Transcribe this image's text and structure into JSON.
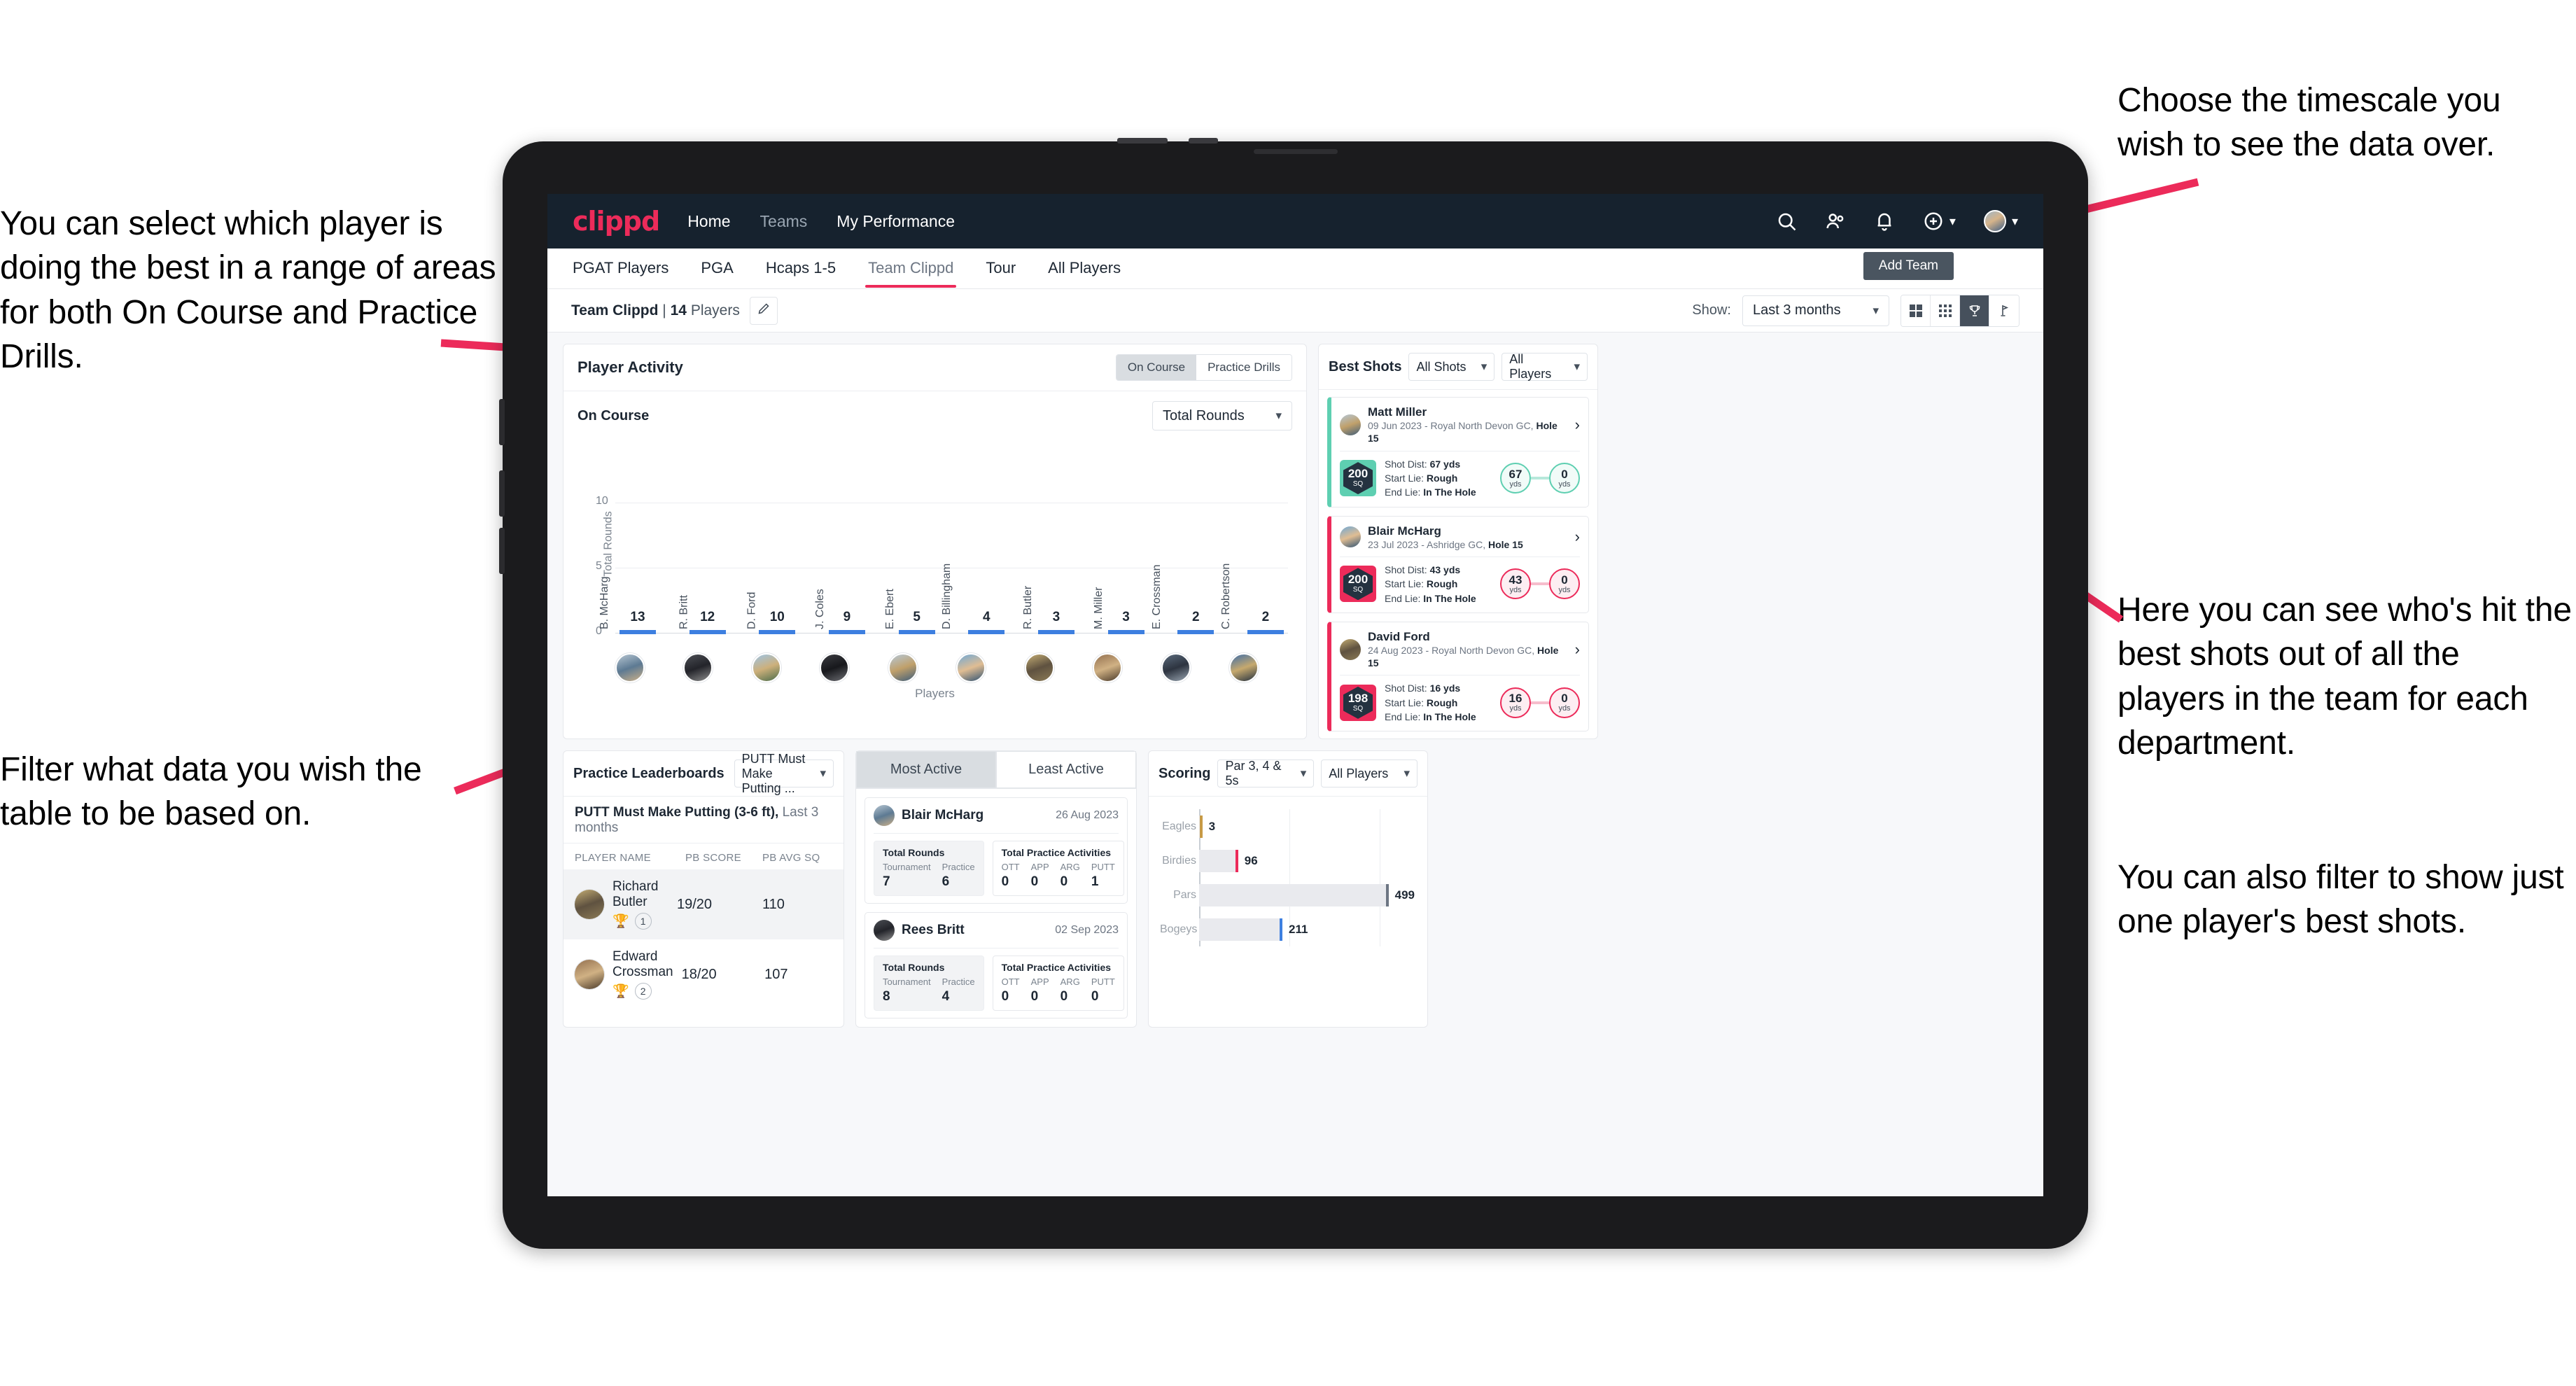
{
  "annotations": {
    "top_right": "Choose the timescale you wish to see the data over.",
    "left_top": "You can select which player is doing the best in a range of areas for both On Course and Practice Drills.",
    "left_bottom": "Filter what data you wish the table to be based on.",
    "right_mid": "Here you can see who's hit the best shots out of all the players in the team for each department.",
    "right_bottom": "You can also filter to show just one player's best shots."
  },
  "topnav": {
    "logo": "clippd",
    "links": [
      {
        "label": "Home",
        "active": true
      },
      {
        "label": "Teams",
        "active": false
      },
      {
        "label": "My Performance",
        "active": true
      }
    ],
    "icons": [
      "search-icon",
      "people-icon",
      "bell-icon",
      "plus-circle-icon",
      "avatar"
    ]
  },
  "tabs": [
    {
      "label": "PGAT Players",
      "active": false
    },
    {
      "label": "PGA",
      "active": false
    },
    {
      "label": "Hcaps 1-5",
      "active": false
    },
    {
      "label": "Team Clippd",
      "active": true
    },
    {
      "label": "Tour",
      "active": false
    },
    {
      "label": "All Players",
      "active": false
    }
  ],
  "add_team_button": "Add Team",
  "toolbar": {
    "team_name": "Team Clippd",
    "separator": "|",
    "player_count": "14",
    "players_word": "Players",
    "edit_icon": "pencil-icon",
    "show_label": "Show:",
    "timescale_value": "Last 3 months",
    "view_modes": [
      "grid-large-icon",
      "grid-small-icon",
      "trophy-icon",
      "flag-icon"
    ],
    "active_view": "trophy-icon"
  },
  "player_activity": {
    "title": "Player Activity",
    "segments": [
      {
        "label": "On Course",
        "active": true
      },
      {
        "label": "Practice Drills",
        "active": false
      }
    ],
    "sub_label": "On Course",
    "metric_value": "Total Rounds"
  },
  "chart_data": {
    "type": "bar",
    "title": "Player Activity",
    "xlabel": "Players",
    "ylabel": "Total Rounds",
    "ylim": [
      0,
      14
    ],
    "yticks": [
      "0",
      "5",
      "10"
    ],
    "grid": true,
    "categories": [
      "B. McHarg",
      "R. Britt",
      "D. Ford",
      "J. Coles",
      "E. Ebert",
      "D. Billingham",
      "R. Butler",
      "M. Miller",
      "E. Crossman",
      "C. Robertson"
    ],
    "values": [
      13,
      12,
      10,
      9,
      5,
      4,
      3,
      3,
      2,
      2
    ],
    "bar_color": "#e9eaee",
    "cap_color": "#3d7fe0"
  },
  "best_shots": {
    "title": "Best Shots",
    "filter_shots": "All Shots",
    "filter_players": "All Players",
    "items": [
      {
        "player": "Matt Miller",
        "meta_prefix": "09 Jun 2023 - Royal North Devon GC, ",
        "meta_hole": "Hole 15",
        "sq": "200",
        "sq_unit": "SQ",
        "accent": "#5ecfb1",
        "shot_dist_label": "Shot Dist: ",
        "shot_dist": "67 yds",
        "start_lie_label": "Start Lie: ",
        "start_lie": "Rough",
        "end_lie_label": "End Lie: ",
        "end_lie": "In The Hole",
        "from_val": "67",
        "from_unit": "yds",
        "to_val": "0",
        "to_unit": "yds"
      },
      {
        "player": "Blair McHarg",
        "meta_prefix": "23 Jul 2023 - Ashridge GC, ",
        "meta_hole": "Hole 15",
        "sq": "200",
        "sq_unit": "SQ",
        "accent": "#ec2b5a",
        "shot_dist_label": "Shot Dist: ",
        "shot_dist": "43 yds",
        "start_lie_label": "Start Lie: ",
        "start_lie": "Rough",
        "end_lie_label": "End Lie: ",
        "end_lie": "In The Hole",
        "from_val": "43",
        "from_unit": "yds",
        "to_val": "0",
        "to_unit": "yds"
      },
      {
        "player": "David Ford",
        "meta_prefix": "24 Aug 2023 - Royal North Devon GC, ",
        "meta_hole": "Hole 15",
        "sq": "198",
        "sq_unit": "SQ",
        "accent": "#ec2b5a",
        "shot_dist_label": "Shot Dist: ",
        "shot_dist": "16 yds",
        "start_lie_label": "Start Lie: ",
        "start_lie": "Rough",
        "end_lie_label": "End Lie: ",
        "end_lie": "In The Hole",
        "from_val": "16",
        "from_unit": "yds",
        "to_val": "0",
        "to_unit": "yds"
      }
    ]
  },
  "practice_leaderboards": {
    "title": "Practice Leaderboards",
    "drill_select": "PUTT Must Make Putting ...",
    "subtitle_bold": "PUTT Must Make Putting (3-6 ft),",
    "subtitle_rest": " Last 3 months",
    "columns": [
      "PLAYER NAME",
      "PB SCORE",
      "PB AVG SQ"
    ],
    "rows": [
      {
        "name": "Richard Butler",
        "rank": "1",
        "trophy": "gold",
        "pb_score": "19/20",
        "pb_avg_sq": "110"
      },
      {
        "name": "Edward Crossman",
        "rank": "2",
        "trophy": "silver",
        "pb_score": "18/20",
        "pb_avg_sq": "107"
      }
    ]
  },
  "activity": {
    "tabs": [
      {
        "label": "Most Active",
        "active": true
      },
      {
        "label": "Least Active",
        "active": false
      }
    ],
    "rounds_title": "Total Rounds",
    "practice_title": "Total Practice Activities",
    "rounds_cols": [
      "Tournament",
      "Practice"
    ],
    "practice_cols": [
      "OTT",
      "APP",
      "ARG",
      "PUTT"
    ],
    "items": [
      {
        "name": "Blair McHarg",
        "date": "26 Aug 2023",
        "rounds": [
          "7",
          "6"
        ],
        "practice": [
          "0",
          "0",
          "0",
          "1"
        ]
      },
      {
        "name": "Rees Britt",
        "date": "02 Sep 2023",
        "rounds": [
          "8",
          "4"
        ],
        "practice": [
          "0",
          "0",
          "0",
          "0"
        ]
      }
    ]
  },
  "scoring": {
    "title": "Scoring",
    "filter_par": "Par 3, 4 & 5s",
    "filter_players": "All Players"
  },
  "scoring_chart": {
    "type": "bar",
    "orientation": "horizontal",
    "title": "Scoring",
    "categories": [
      "Eagles",
      "Birdies",
      "Pars",
      "Bogeys"
    ],
    "values": [
      3,
      96,
      499,
      211
    ],
    "xlim": [
      0,
      560
    ],
    "grid": true,
    "colors": [
      "#c79a45",
      "#ec2b5a",
      "#6d7683",
      "#3d7fe0"
    ],
    "bar_color": "#e9eaee"
  }
}
